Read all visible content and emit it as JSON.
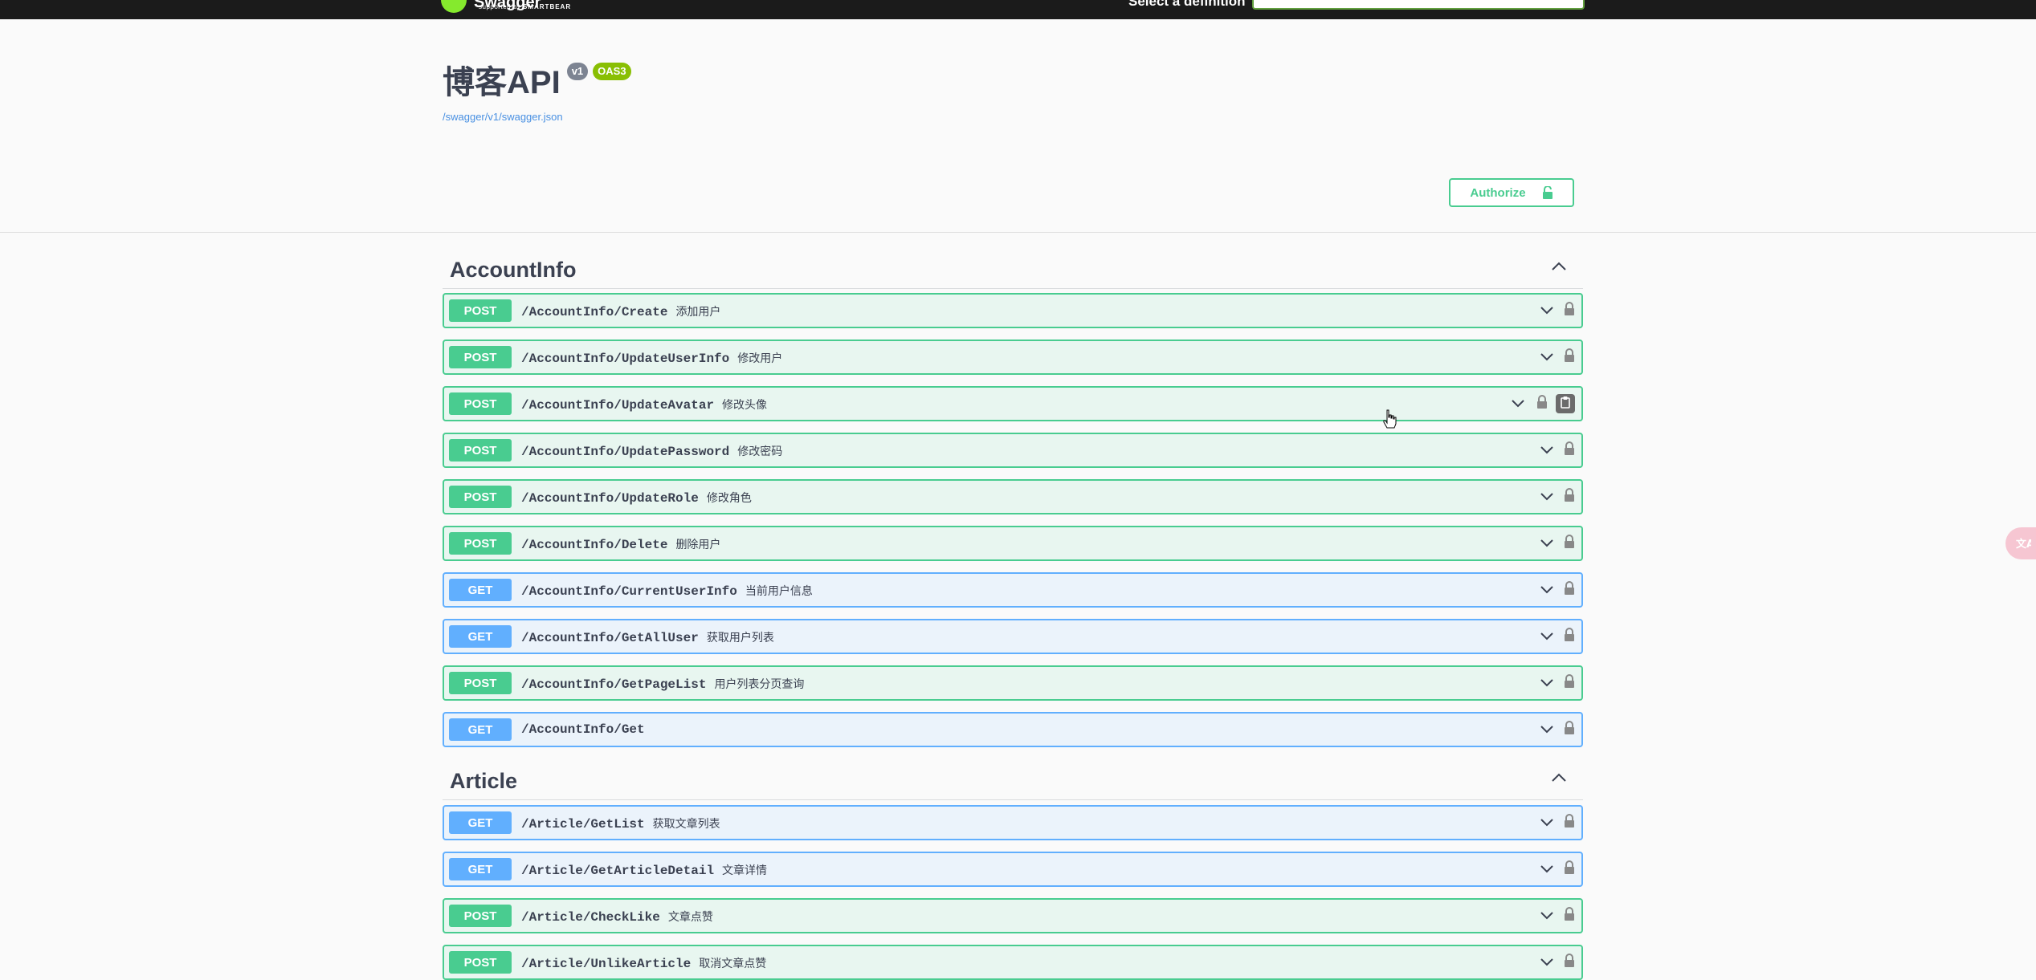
{
  "topbar": {
    "logo_text": "Swagger",
    "logo_sub_prefix": "supported by",
    "logo_sub_brand": "SMARTBEAR",
    "select_label": "Select a definition",
    "select_value": ""
  },
  "info": {
    "title": "博客API",
    "version_badge": "v1",
    "oas_badge": "OAS3",
    "spec_link": "/swagger/v1/swagger.json"
  },
  "authorize": {
    "label": "Authorize"
  },
  "tags": [
    {
      "name": "AccountInfo",
      "operations": [
        {
          "method": "POST",
          "path": "/AccountInfo/Create",
          "summary": "添加用户"
        },
        {
          "method": "POST",
          "path": "/AccountInfo/UpdateUserInfo",
          "summary": "修改用户"
        },
        {
          "method": "POST",
          "path": "/AccountInfo/UpdateAvatar",
          "summary": "修改头像"
        },
        {
          "method": "POST",
          "path": "/AccountInfo/UpdatePassword",
          "summary": "修改密码"
        },
        {
          "method": "POST",
          "path": "/AccountInfo/UpdateRole",
          "summary": "修改角色"
        },
        {
          "method": "POST",
          "path": "/AccountInfo/Delete",
          "summary": "删除用户"
        },
        {
          "method": "GET",
          "path": "/AccountInfo/CurrentUserInfo",
          "summary": "当前用户信息"
        },
        {
          "method": "GET",
          "path": "/AccountInfo/GetAllUser",
          "summary": "获取用户列表"
        },
        {
          "method": "POST",
          "path": "/AccountInfo/GetPageList",
          "summary": "用户列表分页查询"
        },
        {
          "method": "GET",
          "path": "/AccountInfo/Get",
          "summary": ""
        }
      ]
    },
    {
      "name": "Article",
      "operations": [
        {
          "method": "GET",
          "path": "/Article/GetList",
          "summary": "获取文章列表"
        },
        {
          "method": "GET",
          "path": "/Article/GetArticleDetail",
          "summary": "文章详情"
        },
        {
          "method": "POST",
          "path": "/Article/CheckLike",
          "summary": "文章点赞"
        },
        {
          "method": "POST",
          "path": "/Article/UnlikeArticle",
          "summary": "取消文章点赞"
        }
      ]
    }
  ],
  "colors": {
    "post": "#49cc90",
    "get": "#61affe",
    "post_bg": "#e8f6f0",
    "get_bg": "#ebf3fb",
    "topbar": "#1b1b1b"
  }
}
